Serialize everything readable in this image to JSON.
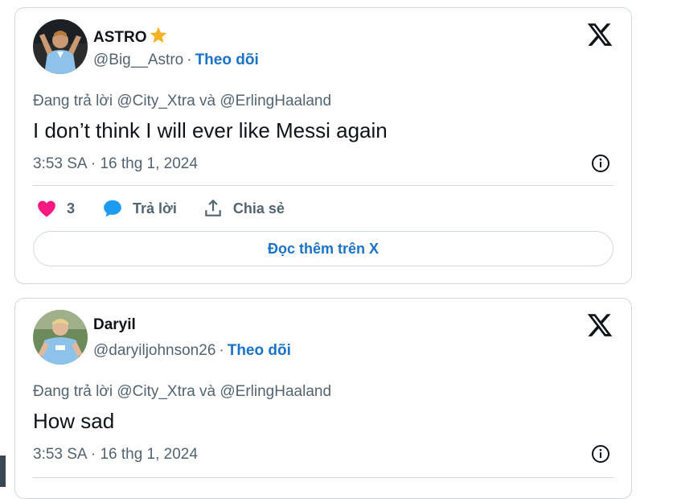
{
  "tweets": [
    {
      "display_name": "ASTRO",
      "handle": "@Big__Astro",
      "separator": "·",
      "follow_label": "Theo dõi",
      "reply_to": "Đang trả lời @City_Xtra và @ErlingHaaland",
      "text": "I don’t think I will ever like Messi again",
      "timestamp": "3:53 SA · 16 thg 1, 2024",
      "likes": "3",
      "reply_label": "Trả lời",
      "share_label": "Chia sẻ",
      "read_more_label": "Đọc thêm trên X",
      "avatar_icon": "sky-blue-jersey-player-avatar"
    },
    {
      "display_name": "Daryil",
      "handle": "@daryiljohnson26",
      "separator": "·",
      "follow_label": "Theo dõi",
      "reply_to": "Đang trả lời @City_Xtra và @ErlingHaaland",
      "text": "How sad",
      "timestamp": "3:53 SA · 16 thg 1, 2024",
      "avatar_icon": "sky-blue-jersey-player-avatar"
    }
  ],
  "colors": {
    "link": "#1a73c8",
    "heart": "#f91880",
    "muted": "#536471",
    "border": "#cfd9de"
  }
}
